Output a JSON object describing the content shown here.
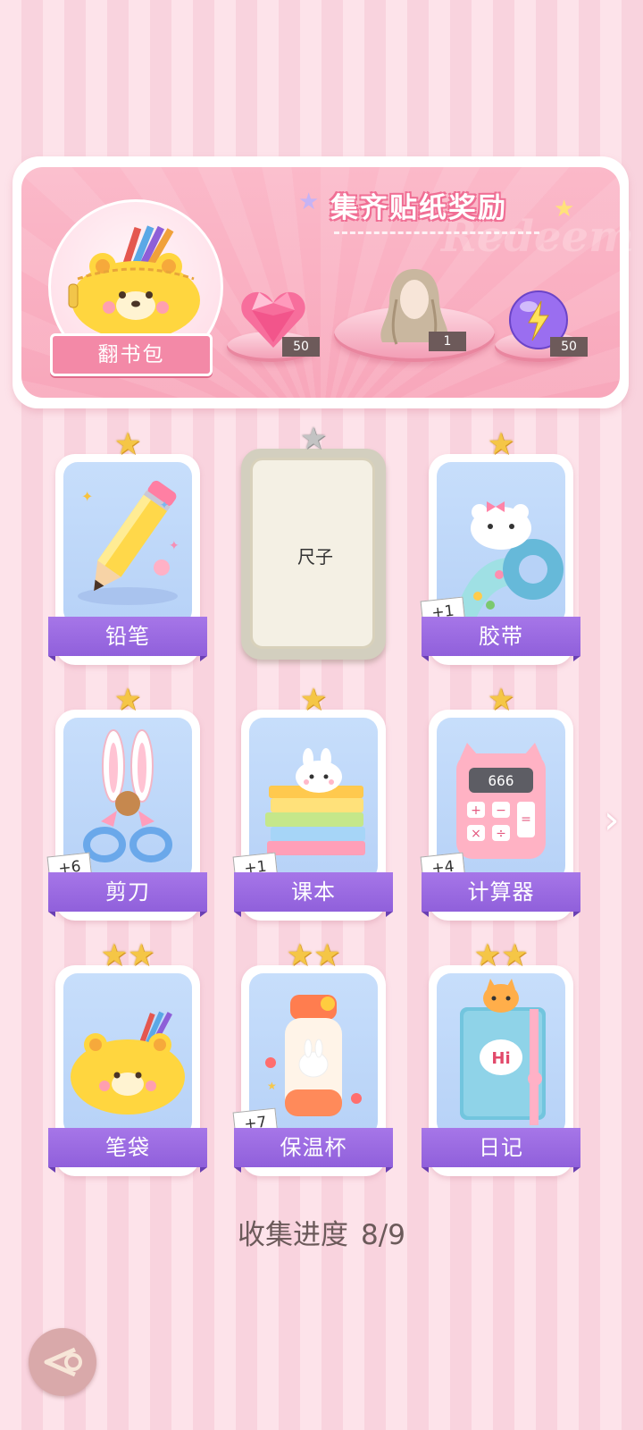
{
  "banner": {
    "title": "集齐贴纸奖励",
    "ghost_text": "Redeem",
    "bag_label": "翻书包",
    "rewards": [
      {
        "name": "heart-gem-icon",
        "count": "50"
      },
      {
        "name": "outfit-hair-icon",
        "count": "1"
      },
      {
        "name": "energy-orb-icon",
        "count": "50"
      }
    ]
  },
  "stickers": [
    {
      "label": "铅笔",
      "stars": 1,
      "locked": false,
      "plus": "",
      "icon": "pencil-icon"
    },
    {
      "label": "尺子",
      "stars": 1,
      "locked": true,
      "plus": "",
      "icon": "ruler-icon"
    },
    {
      "label": "胶带",
      "stars": 1,
      "locked": false,
      "plus": "+1",
      "icon": "tape-icon"
    },
    {
      "label": "剪刀",
      "stars": 1,
      "locked": false,
      "plus": "+6",
      "icon": "scissors-icon"
    },
    {
      "label": "课本",
      "stars": 1,
      "locked": false,
      "plus": "+1",
      "icon": "textbook-icon"
    },
    {
      "label": "计算器",
      "stars": 1,
      "locked": false,
      "plus": "+4",
      "icon": "calculator-icon"
    },
    {
      "label": "笔袋",
      "stars": 2,
      "locked": false,
      "plus": "",
      "icon": "pencil-case-icon"
    },
    {
      "label": "保温杯",
      "stars": 2,
      "locked": false,
      "plus": "+7",
      "icon": "thermos-icon"
    },
    {
      "label": "日记",
      "stars": 2,
      "locked": false,
      "plus": "",
      "icon": "diary-icon"
    }
  ],
  "calculator_display": "666",
  "diary_text": "Hi",
  "progress": {
    "label": "收集进度",
    "value": "8/9",
    "collected": 8,
    "total": 9
  },
  "colors": {
    "accent_pink": "#f389a7",
    "label_purple": "#9a69e0",
    "star_gold": "#f5c646"
  }
}
